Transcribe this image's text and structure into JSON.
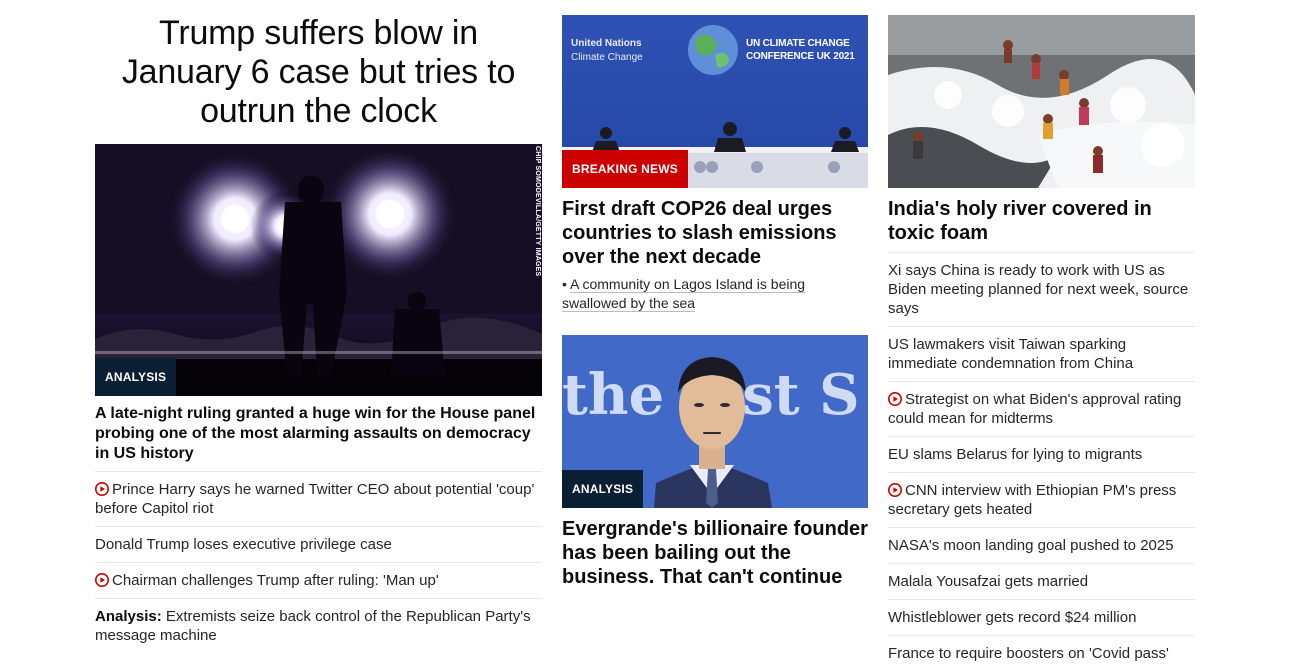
{
  "column1": {
    "main_headline": "Trump suffers blow in January 6 case but tries to outrun the clock",
    "photo_credit": "CHIP SOMODEVILLA/GETTY IMAGES",
    "badge": "ANALYSIS",
    "lead": "A late-night ruling granted a huge win for the House panel probing one of the most alarming assaults on democracy in US history",
    "items": [
      {
        "video": true,
        "prefix": "",
        "text": "Prince Harry says he warned Twitter CEO about potential 'coup' before Capitol riot"
      },
      {
        "video": false,
        "prefix": "",
        "text": "Donald Trump loses executive privilege case"
      },
      {
        "video": true,
        "prefix": "",
        "text": "Chairman challenges Trump after ruling: 'Man up'"
      },
      {
        "video": false,
        "prefix": "Analysis:",
        "text": "Extremists seize back control of the Republican Party's message machine"
      }
    ]
  },
  "column2": {
    "story1": {
      "banner_left_line1": "United Nations",
      "banner_left_line2": "Climate Change",
      "banner_right_line1": "UN CLIMATE CHANGE",
      "banner_right_line2": "CONFERENCE UK 2021",
      "badge": "BREAKING NEWS",
      "headline": "First draft COP26 deal urges countries to slash emissions over the next decade",
      "bullet": "A community on Lagos Island is being swallowed by the sea"
    },
    "story2": {
      "bg_text": "the    st S",
      "badge": "ANALYSIS",
      "headline": "Evergrande's billionaire founder has been bailing out the business. That can't continue"
    }
  },
  "column3": {
    "headline": "India's holy river covered in toxic foam",
    "items": [
      {
        "video": false,
        "text": "Xi says China is ready to work with US as Biden meeting planned for next week, source says"
      },
      {
        "video": false,
        "text": "US lawmakers visit Taiwan sparking immediate condemnation from China"
      },
      {
        "video": true,
        "text": "Strategist on what Biden's approval rating could mean for midterms"
      },
      {
        "video": false,
        "text": "EU slams Belarus for lying to migrants"
      },
      {
        "video": true,
        "text": "CNN interview with Ethiopian PM's press secretary gets heated"
      },
      {
        "video": false,
        "text": "NASA's moon landing goal pushed to 2025"
      },
      {
        "video": false,
        "text": "Malala Yousafzai gets married"
      },
      {
        "video": false,
        "text": "Whistleblower gets record $24 million"
      },
      {
        "video": false,
        "text": "France to require boosters on 'Covid pass'"
      }
    ]
  },
  "colors": {
    "accent_red": "#cc0000",
    "badge_dark": "#0a1f33"
  }
}
